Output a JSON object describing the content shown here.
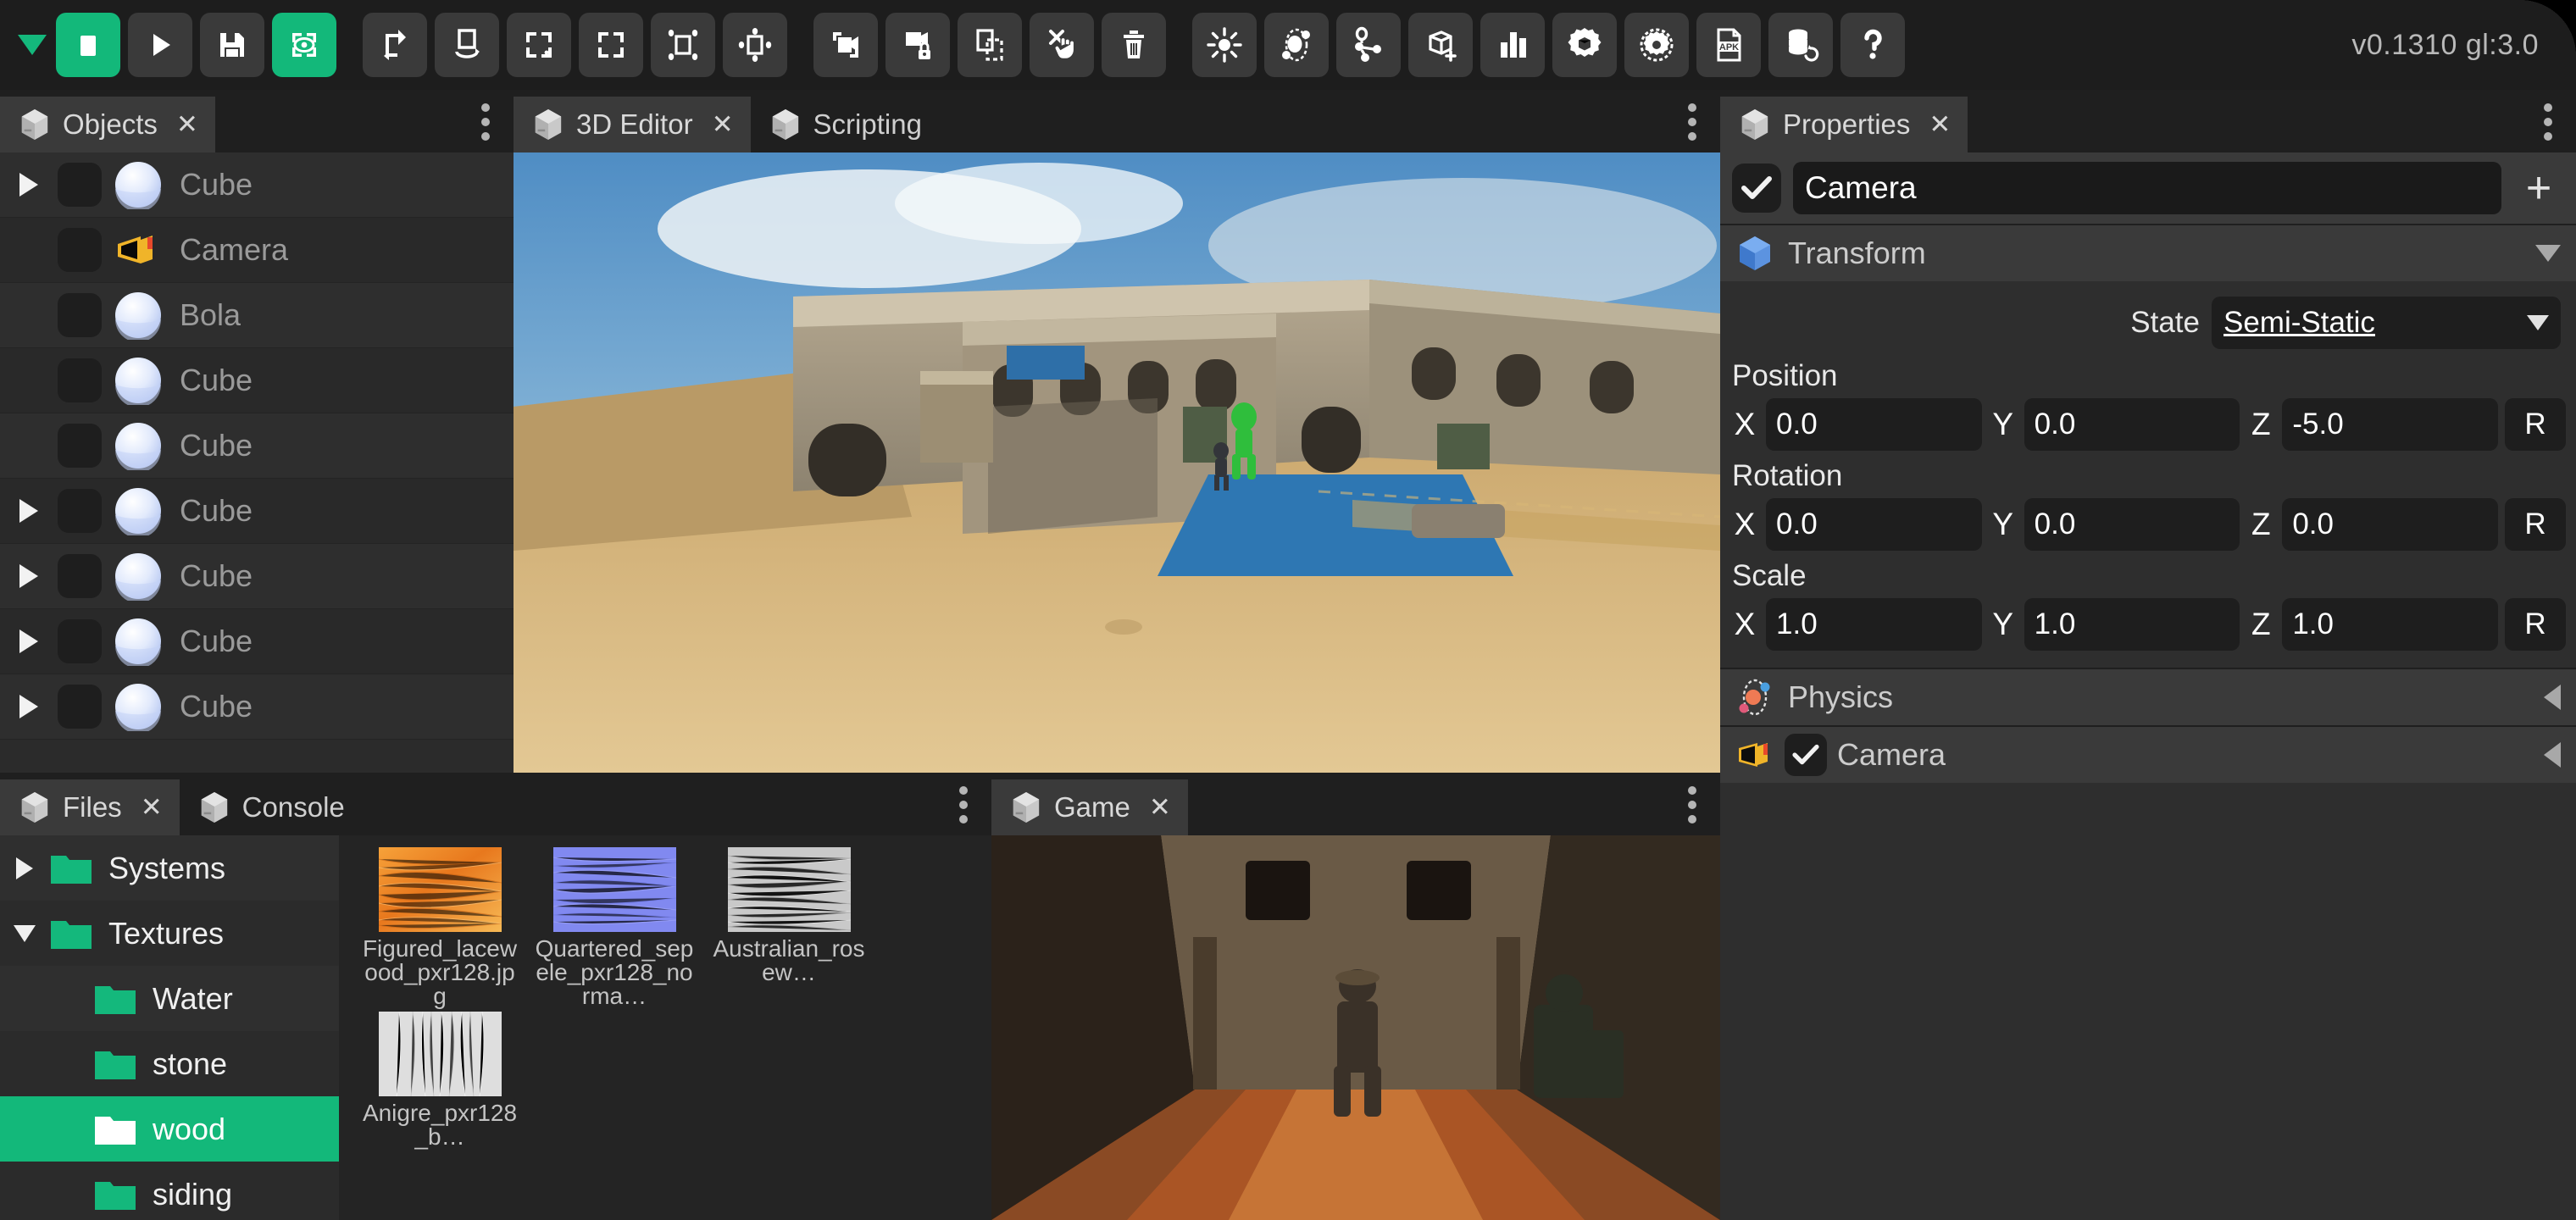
{
  "toolbar": {
    "menu_caret": "menu-caret",
    "version": "v0.1310 gl:3.0",
    "buttons": [
      {
        "name": "stop-button",
        "icon": "stop-square",
        "accent": true
      },
      {
        "name": "play-button",
        "icon": "play-triangle",
        "accent": false
      },
      {
        "name": "save-button",
        "icon": "floppy-disk",
        "accent": false
      },
      {
        "name": "view-focus-button",
        "icon": "eye-in-frame",
        "accent": true
      },
      {
        "name": "move-object-button",
        "icon": "move-arrow",
        "accent": false
      },
      {
        "name": "rotate-object-button",
        "icon": "rotate-arrow",
        "accent": false
      },
      {
        "name": "scale-object-button",
        "icon": "scale-corners",
        "accent": false
      },
      {
        "name": "select-bounds-button",
        "icon": "select-corners",
        "accent": false
      },
      {
        "name": "snap-points-button",
        "icon": "snap-dots",
        "accent": false
      },
      {
        "name": "snap-edges-button",
        "icon": "snap-edge-dots",
        "accent": false
      },
      {
        "name": "duplicate-object-button",
        "icon": "duplicate-frames",
        "accent": false
      },
      {
        "name": "lock-object-button",
        "icon": "lock-frame",
        "accent": false
      },
      {
        "name": "copy-bounds-button",
        "icon": "dashed-frame",
        "accent": false
      },
      {
        "name": "deselect-button",
        "icon": "hand-cancel",
        "accent": false
      },
      {
        "name": "delete-button",
        "icon": "trash-can",
        "accent": false
      },
      {
        "name": "add-light-button",
        "icon": "sun-light",
        "accent": false
      },
      {
        "name": "add-physics-button",
        "icon": "atom-orbit",
        "accent": false
      },
      {
        "name": "add-joint-button",
        "icon": "node-graph",
        "accent": false
      },
      {
        "name": "add-mesh-button",
        "icon": "cube-plus",
        "accent": false
      },
      {
        "name": "statistics-button",
        "icon": "bar-chart",
        "accent": false
      },
      {
        "name": "engine-settings-button",
        "icon": "gear-cube",
        "accent": false
      },
      {
        "name": "project-settings-button",
        "icon": "gear-target",
        "accent": false
      },
      {
        "name": "export-apk-button",
        "icon": "apk-file",
        "accent": false
      },
      {
        "name": "reload-assets-button",
        "icon": "database-refresh",
        "accent": false
      },
      {
        "name": "help-button",
        "icon": "question-mark",
        "accent": false
      }
    ]
  },
  "objects_panel": {
    "tabs": [
      {
        "label": "Objects",
        "active": true,
        "closable": true
      }
    ],
    "rows": [
      {
        "name": "Cube",
        "expandable": true,
        "icon": "sphere-icon",
        "checked": false
      },
      {
        "name": "Camera",
        "expandable": false,
        "icon": "camera-icon",
        "checked": false
      },
      {
        "name": "Bola",
        "expandable": false,
        "icon": "sphere-icon",
        "checked": false
      },
      {
        "name": "Cube",
        "expandable": false,
        "icon": "sphere-icon",
        "checked": false
      },
      {
        "name": "Cube",
        "expandable": false,
        "icon": "sphere-icon",
        "checked": false
      },
      {
        "name": "Cube",
        "expandable": true,
        "icon": "sphere-icon",
        "checked": false
      },
      {
        "name": "Cube",
        "expandable": true,
        "icon": "sphere-icon",
        "checked": false
      },
      {
        "name": "Cube",
        "expandable": true,
        "icon": "sphere-icon",
        "checked": false
      },
      {
        "name": "Cube",
        "expandable": true,
        "icon": "sphere-icon",
        "checked": false
      }
    ]
  },
  "editor_panel": {
    "tabs": [
      {
        "label": "3D Editor",
        "active": true,
        "closable": true
      },
      {
        "label": "Scripting",
        "active": false,
        "closable": false
      }
    ]
  },
  "game_panel": {
    "tabs": [
      {
        "label": "Game",
        "active": true,
        "closable": true
      }
    ]
  },
  "files_panel": {
    "tabs": [
      {
        "label": "Files",
        "active": true,
        "closable": true
      },
      {
        "label": "Console",
        "active": false,
        "closable": false
      }
    ],
    "tree": [
      {
        "label": "Systems",
        "indent": 0,
        "expandable": true,
        "expanded": false,
        "selected": false
      },
      {
        "label": "Textures",
        "indent": 0,
        "expandable": true,
        "expanded": true,
        "selected": false
      },
      {
        "label": "Water",
        "indent": 1,
        "expandable": false,
        "expanded": false,
        "selected": false
      },
      {
        "label": "stone",
        "indent": 1,
        "expandable": false,
        "expanded": false,
        "selected": false
      },
      {
        "label": "wood",
        "indent": 1,
        "expandable": false,
        "expanded": false,
        "selected": true
      },
      {
        "label": "siding",
        "indent": 1,
        "expandable": false,
        "expanded": false,
        "selected": false
      }
    ],
    "files": [
      {
        "label": "Figured_lacewood_pxr128.jpg",
        "thumb": "orange-wood"
      },
      {
        "label": "Quartered_sepele_pxr128_norma…",
        "thumb": "blue-normal"
      },
      {
        "label": "Australian_rosew…",
        "thumb": "grey-wood"
      },
      {
        "label": "Anigre_pxr128_b…",
        "thumb": "light-grey-wood"
      }
    ]
  },
  "properties_panel": {
    "tabs": [
      {
        "label": "Properties",
        "active": true,
        "closable": true
      }
    ],
    "object": {
      "enabled": true,
      "name": "Camera",
      "add_component_label": "+"
    },
    "transform": {
      "title": "Transform",
      "expanded": true,
      "state_label": "State",
      "state_value": "Semi-Static",
      "position": {
        "label": "Position",
        "x": "0.0",
        "y": "0.0",
        "z": "-5.0",
        "reset": "R"
      },
      "rotation": {
        "label": "Rotation",
        "x": "0.0",
        "y": "0.0",
        "z": "0.0",
        "reset": "R"
      },
      "scale": {
        "label": "Scale",
        "x": "1.0",
        "y": "1.0",
        "z": "1.0",
        "reset": "R"
      },
      "axis_x": "X",
      "axis_y": "Y",
      "axis_z": "Z"
    },
    "sections": [
      {
        "title": "Physics",
        "icon": "atom-orbit-icon",
        "expanded": false,
        "has_checkbox": false,
        "checked": false
      },
      {
        "title": "Camera",
        "icon": "camera-icon",
        "expanded": false,
        "has_checkbox": true,
        "checked": true
      }
    ]
  },
  "colors": {
    "accent_green": "#13b87a",
    "panel_bg": "#2e2e2e",
    "toolbar_bg": "#1d1d1d",
    "text_primary": "#ffffff",
    "text_muted": "#9a9a9a"
  }
}
